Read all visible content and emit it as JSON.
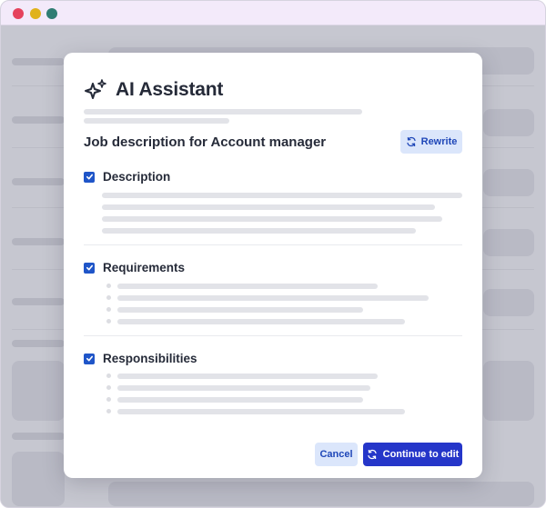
{
  "window": {
    "controls": [
      "close-dot",
      "minimize-dot",
      "maximize-dot"
    ],
    "colors": {
      "close": "#e5425c",
      "minimize": "#e0b21c",
      "maximize": "#2f7d73",
      "titlebar": "#f3eafa"
    }
  },
  "modal": {
    "title": "AI Assistant",
    "title_icon": "sparkle-icon",
    "subtitle": "Job description for Account manager",
    "rewrite_label": "Rewrite",
    "rewrite_icon": "refresh-icon",
    "sections": [
      {
        "title": "Description",
        "checked": true,
        "style": "paragraph"
      },
      {
        "title": "Requirements",
        "checked": true,
        "style": "bullets"
      },
      {
        "title": "Responsibilities",
        "checked": true,
        "style": "bullets"
      }
    ],
    "cancel_label": "Cancel",
    "continue_label": "Continue to edit",
    "continue_icon": "refresh-icon"
  },
  "colors": {
    "primary": "#2536c9",
    "secondary_bg": "#dbe6fb",
    "secondary_text": "#1f47b8",
    "checkbox": "#1f55c8"
  }
}
